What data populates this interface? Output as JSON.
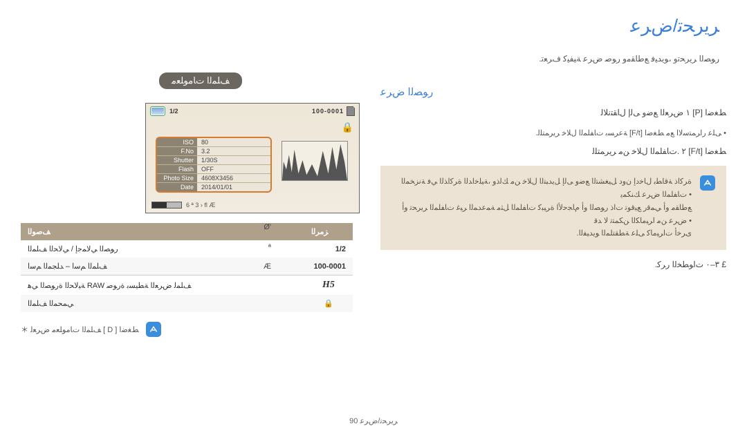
{
  "header": {
    "title": "ﺮﻳﺮﺤﺗ/ضﺮﻋ",
    "subline": ".ﺭﻮﺼﻟﺍ ﺮﻳﺮﺤﺗﻭ ،ﻮﻳﺪﻴﻓ ﻊﻃﺎﻘﻣﻭ ﺭﻮﺻ ﺽﺮﻋ ﺔﻴﻔﻴﻛ ﻑﺮﻌﺗ"
  },
  "left": {
    "section_label": "ﻒﻠﻤﻟﺍ ﺕﺎﻣﻮﻠﻌﻣ",
    "callouts": [
      "Ø'",
      "ª",
      "Æ"
    ],
    "screen": {
      "mode_icon": "scene-icon",
      "frac": "1/2",
      "filecount": "100-0001",
      "lock": "⊶",
      "info_rows": [
        {
          "k": "ISO",
          "v": "80"
        },
        {
          "k": "F.No",
          "v": "3.2"
        },
        {
          "k": "Shutter",
          "v": "1/30S"
        },
        {
          "k": "Flash",
          "v": "OFF"
        },
        {
          "k": "Photo Size",
          "v": "4608X3456"
        },
        {
          "k": "Date",
          "v": "2014/01/01"
        }
      ],
      "bottom_text": "6  ª  3 › fl   Æ"
    },
    "table": {
      "headers": [
        "ﺰﻣﺮﻟﺍ",
        "ﻒﺻﻮﻟﺍ"
      ],
      "rows": [
        {
          "desc": "ﺭﻮﺼﻟﺍ ﻲﻟﺎﻤﺟﺇ / ﻲﻟﺎﺤﻟﺍ ﻒﻠﻤﻟﺍ",
          "icon_text": "1/2",
          "icon": ""
        },
        {
          "desc": "ﻒﻠﻤﻟﺍ ﻢﺳﺍ – ﺪﻠﺠﻤﻟﺍ ﻢﺳﺍ",
          "icon_text": "100-0001",
          "icon": ""
        },
        {
          "desc": "ﺔﻴﻟﺎﺤﻟﺍ ةﺭﻮﺼﻟﺍ ﻲﻫ RAW ﻒﻠﻤﻟ ﺽﺮﻌﻟﺍ ﺔﻄﻴﺴﺑ ةﺭﻮﺻ",
          "icon_text": "",
          "icon": "H5"
        },
        {
          "desc": "ﻲﻤﺤﻤﻟﺍ ﻒﻠﻤﻟﺍ",
          "icon_text": "",
          "icon": "lock"
        }
      ]
    },
    "note_text": "＊ ﻒﻠﻤﻟﺍ ﺕﺎﻣﻮﻠﻌﻣ ﺽﺮﻌﻟ [ D ] ﻂﻐﺿﺍ"
  },
  "right": {
    "subhead": "ﺭﻮﺼﻟﺍ ضﺮﻋ",
    "steps": [
      "١ ﺽﺮﻌﻟﺍ ﻊﺿﻭ ﻰﻟﺇ ﻝﺎﻘﺘﻧﻼﻟ [P] ﻂﻐﺿﺍ",
      "٢ .ﺕﺎﻔﻠﻤﻟﺍ ﻝﻼﺧ ﻦﻣ ﺮﻳﺮﻤﺘﻠﻟ [F/t] ﻂﻐﺿﺍ"
    ],
    "substeps": [
      ".ﺔﻋﺮﺴﺑ ﺕﺎﻔﻠﻤﻟﺍ ﻝﻼﺧ ﺮﻳﺮﻤﺘﻠﻟ [F/t] ﻰﻠﻋ ﺭﺍﺮﻤﺘﺳﻻﺍ ﻊﻣ ﻂﻐﺿﺍ •"
    ],
    "note_lines": [
      "ﺓﺮﻛﺍﺫ ﺔﻗﺎﻄﺑ ﻝﺎﺧﺩﺇ ﻥﻭﺩ ﻞﻴﻐﺸﺘﻟﺍ ﻊﺿﻭ ﻰﻟﺇ ﻞﻳﺪﺒﺘﻟﺍ ﻝﻼﺧ ﻦﻣ ﻚﻟﺫﻭ ،ﺔﻴﻠﺧﺍﺪﻟﺍ ﺓﺮﻛﺍﺬﻟﺍ ﻲﻓ ﺔﻧﺰﺨﻤﻟﺍ ﺕﺎﻔﻠﻤﻟﺍ ﺽﺮﻋ ﻚﻨﻜﻤﻳ •",
      "ﻊﻃﺎﻘﻣ ﻭﺃ ﻲﻤﻗﺭ ﻊﻴﻗﻮﺗ ﺕﺍﺫ ﺭﻮﺼﻟﺍ ﻭﺃ ﻡﺎﺠﺣﻷﺍ ةﺮﻴﺒﻛ ﺕﺎﻔﻠﻤﻟﺍ ﻞﺜﻣ ﺔﻤﻋﺪﻤﻟﺍ ﺮﻴﻏ ﺕﺎﻔﻠﻤﻟﺍ ﺮﻳﺮﺤﺗ ﻭﺃ ﺽﺮﻋ ﻦﻣ ﺍﺮﻴﻣﺎﻜﻟﺍ ﻦﻜﻤﺘﺗ ﻻ ﺪﻗ •",
      ".ﻯﺮﺧﺃ ﺕﺍﺮﻴﻣﺎﻛ ﻰﻠﻋ ﺔﻄﻘﺘﻠﻤﻟﺍ ﻮﻳﺪﻴﻔﻟﺍ"
    ],
    "footer_step": ".٣–٠ ﺕﺍﻮﻄﺨﻟﺍ ﺭﺮﻛ  £"
  },
  "page_num": "90  ﺮﻳﺮﺤﺗ/ﺽﺮﻋ"
}
